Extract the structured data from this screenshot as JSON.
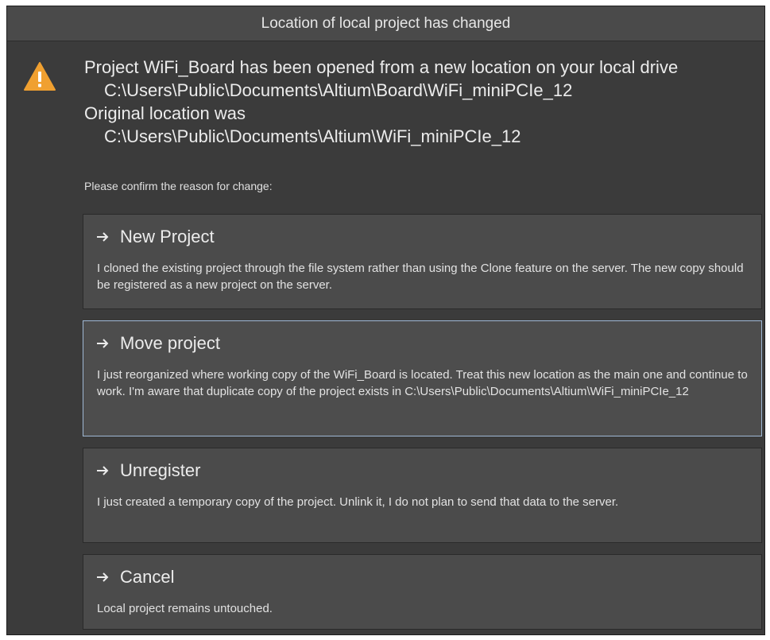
{
  "dialog": {
    "title": "Location of local project has changed",
    "message": {
      "line1": "Project WiFi_Board has been opened from a new location on your local drive",
      "new_path": "C:\\Users\\Public\\Documents\\Altium\\Board\\WiFi_miniPCIe_12",
      "line2": "Original location was",
      "original_path": "C:\\Users\\Public\\Documents\\Altium\\WiFi_miniPCIe_12"
    },
    "prompt": "Please confirm the reason for change:",
    "icon": "warning-icon",
    "colors": {
      "background": "#3b3b3b",
      "option_background": "#4b4b4b",
      "selected_border": "#9fb8d4",
      "warning": "#f0a030"
    }
  },
  "options": [
    {
      "title": "New Project",
      "description": "I cloned the existing project through the file system rather than using the Clone feature on the server. The new copy should be registered as a new project on the server.",
      "selected": false
    },
    {
      "title": "Move project",
      "description": "I just reorganized where working copy of the WiFi_Board is located. Treat this new location as the main one and continue to work. I'm aware that duplicate copy of the project exists in C:\\Users\\Public\\Documents\\Altium\\WiFi_miniPCIe_12",
      "selected": true
    },
    {
      "title": "Unregister",
      "description": "I just created a temporary copy of the project. Unlink it, I do not plan to send that data to the server.",
      "selected": false
    },
    {
      "title": "Cancel",
      "description": "Local project remains untouched.",
      "selected": false
    }
  ]
}
